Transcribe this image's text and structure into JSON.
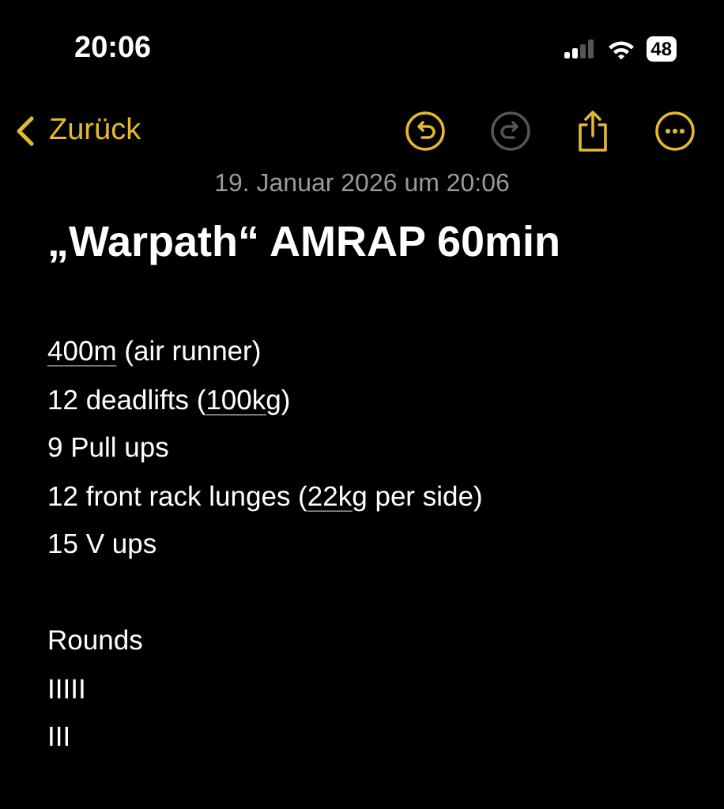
{
  "status_bar": {
    "time": "20:06",
    "battery": "48"
  },
  "nav": {
    "back_label": "Zurück",
    "actions": [
      {
        "kind": "undo",
        "disabled": false
      },
      {
        "kind": "redo",
        "disabled": true
      },
      {
        "kind": "share",
        "disabled": false
      },
      {
        "kind": "more",
        "disabled": false
      }
    ]
  },
  "note": {
    "date": "19. Januar 2026 um 20:06",
    "title": "„Warpath“ AMRAP 60min",
    "lines": [
      {
        "gap_before": false,
        "parts": [
          {
            "text": "400m",
            "underlined": true
          },
          {
            "text": " (air runner)",
            "underlined": false
          }
        ]
      },
      {
        "gap_before": false,
        "parts": [
          {
            "text": "12 deadlifts (",
            "underlined": false
          },
          {
            "text": "100kg",
            "underlined": true
          },
          {
            "text": ")",
            "underlined": false
          }
        ]
      },
      {
        "gap_before": false,
        "parts": [
          {
            "text": "9 Pull ups",
            "underlined": false
          }
        ]
      },
      {
        "gap_before": false,
        "parts": [
          {
            "text": "12 front rack lunges (",
            "underlined": false
          },
          {
            "text": "22kg",
            "underlined": true
          },
          {
            "text": " per side)",
            "underlined": false
          }
        ]
      },
      {
        "gap_before": false,
        "parts": [
          {
            "text": "15 V ups",
            "underlined": false
          }
        ]
      },
      {
        "gap_before": true,
        "parts": [
          {
            "text": "Rounds",
            "underlined": false
          }
        ]
      },
      {
        "gap_before": false,
        "parts": [
          {
            "text": "IIIII",
            "underlined": false
          }
        ]
      },
      {
        "gap_before": false,
        "parts": [
          {
            "text": "III",
            "underlined": false
          }
        ]
      }
    ]
  }
}
